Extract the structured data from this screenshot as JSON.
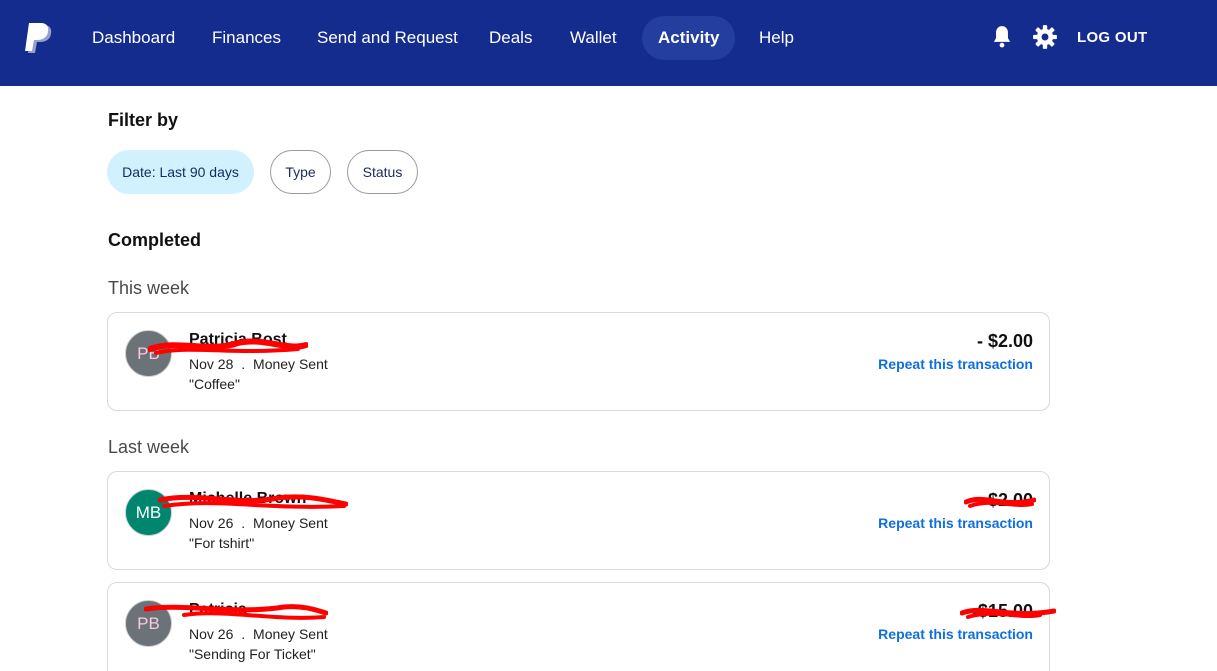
{
  "nav": {
    "items": [
      {
        "label": "Dashboard"
      },
      {
        "label": "Finances"
      },
      {
        "label": "Send and Request"
      },
      {
        "label": "Deals"
      },
      {
        "label": "Wallet"
      },
      {
        "label": "Activity",
        "active": true
      },
      {
        "label": "Help"
      }
    ],
    "logout_label": "LOG OUT",
    "icons": [
      "paypal-logo-icon",
      "bell-icon",
      "gear-icon"
    ]
  },
  "filter": {
    "title": "Filter by",
    "chips": [
      {
        "label": "Date: Last 90 days",
        "selected": true
      },
      {
        "label": "Type",
        "selected": false
      },
      {
        "label": "Status",
        "selected": false
      }
    ]
  },
  "activity": {
    "section_title": "Completed",
    "groups": [
      {
        "title": "This week",
        "transactions": [
          {
            "initials": "PB",
            "name": "Patricia Bost",
            "date": "Nov 28",
            "type": "Money Sent",
            "note": "\"Coffee\"",
            "amount": "- $2.00",
            "repeat_label": "Repeat this transaction",
            "avatar_color": "#6c7378"
          }
        ]
      },
      {
        "title": "Last week",
        "transactions": [
          {
            "initials": "MB",
            "name": "Michelle Brown",
            "date": "Nov 26",
            "type": "Money Sent",
            "note": "\"For tshirt\"",
            "amount": "-$2.00",
            "repeat_label": "Repeat this transaction",
            "avatar_color": "#00856f"
          },
          {
            "initials": "PB",
            "name": "Patricia",
            "date": "Nov 26",
            "type": "Money Sent",
            "note": "\"Sending For Ticket\"",
            "amount": "-$15.00",
            "repeat_label": "Repeat this transaction",
            "avatar_color": "#6c7378"
          }
        ]
      }
    ],
    "separator": "."
  },
  "colors": {
    "nav_bg": "#142c8e",
    "active_tab_bg": "#233e9e",
    "chip_selected_bg": "#d1f1ff",
    "link_blue": "#0f6fde",
    "redaction_red": "#ff0000"
  }
}
